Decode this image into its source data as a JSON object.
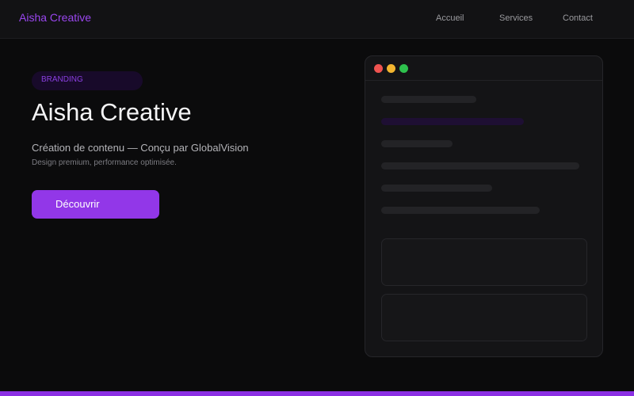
{
  "header": {
    "brand": "Aisha Creative",
    "nav": [
      "Accueil",
      "Services",
      "Contact"
    ]
  },
  "hero": {
    "badge": "BRANDING",
    "title": "Aisha Creative",
    "subtitle": "Création de contenu — Conçu par GlobalVision",
    "tagline": "Design premium, performance optimisée.",
    "cta_label": "Découvrir"
  },
  "colors": {
    "accent": "#9237e8",
    "background": "#0b0b0c",
    "window_dot_red": "#ef5350",
    "window_dot_yellow": "#f2b530",
    "window_dot_green": "#2ec14d"
  }
}
